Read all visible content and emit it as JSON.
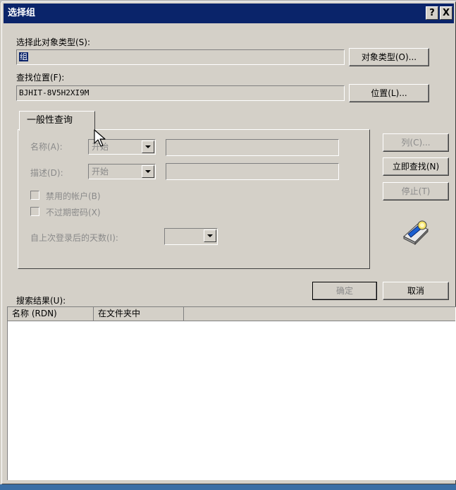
{
  "dialog": {
    "title": "选择组",
    "help_btn": "?",
    "close_btn": "X"
  },
  "object_type": {
    "label": "选择此对象类型(S):",
    "value": "组",
    "button": "对象类型(O)..."
  },
  "location": {
    "label": "查找位置(F):",
    "value": "BJHIT-8V5H2XI9M",
    "button": "位置(L)..."
  },
  "query": {
    "tab_label": "一般性查询",
    "name_label": "名称(A):",
    "name_mode": "开始",
    "desc_label": "描述(D):",
    "desc_mode": "开始",
    "disabled_accounts": "禁用的帐户(B)",
    "non_expiring_pwd": "不过期密码(X)",
    "days_since_logon": "自上次登录后的天数(I):"
  },
  "side_buttons": {
    "columns": "列(C)...",
    "find_now": "立即查找(N)",
    "stop": "停止(T)"
  },
  "actions": {
    "ok": "确定",
    "cancel": "取消"
  },
  "results": {
    "label": "搜索结果(U):",
    "columns": [
      "名称 (RDN)",
      "在文件夹中"
    ]
  },
  "icons": {
    "search": "search-flashlight-icon",
    "cursor": "mouse-cursor-icon"
  }
}
